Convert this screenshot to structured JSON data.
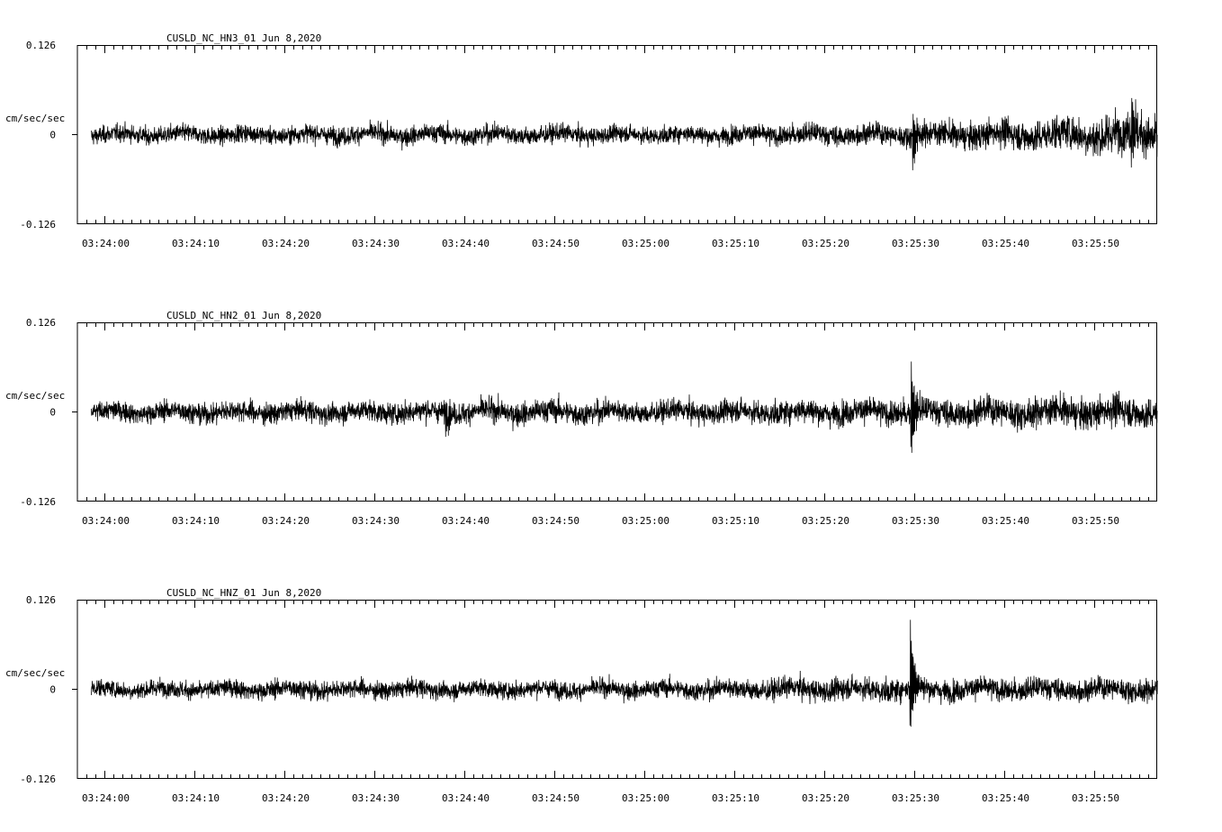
{
  "chart_data": [
    {
      "type": "line",
      "title": "CUSLD_NC_HN3_01  Jun 8,2020",
      "ylabel": "cm/sec/sec",
      "ylim": [
        -0.126,
        0.126
      ],
      "y_ticks": [
        "0.126",
        "0",
        "-0.126"
      ],
      "x_ticks": [
        "03:24:00",
        "03:24:10",
        "03:24:20",
        "03:24:30",
        "03:24:40",
        "03:24:50",
        "03:25:00",
        "03:25:10",
        "03:25:20",
        "03:25:30",
        "03:25:40",
        "03:25:50"
      ],
      "x_range_seconds": [
        -2.9,
        57.4
      ],
      "noise_envelope": [
        [
          -1.5,
          0.02
        ],
        [
          10,
          0.021
        ],
        [
          20,
          0.02
        ],
        [
          30,
          0.022
        ],
        [
          40,
          0.022
        ],
        [
          50,
          0.021
        ],
        [
          60,
          0.019
        ],
        [
          70,
          0.021
        ],
        [
          80,
          0.024
        ],
        [
          89,
          0.024
        ],
        [
          90,
          0.028
        ],
        [
          100,
          0.033
        ],
        [
          105,
          0.038
        ],
        [
          110,
          0.045
        ],
        [
          114,
          0.048
        ]
      ],
      "events": [
        {
          "x": 89.8,
          "max": 0.04,
          "min": -0.05
        },
        {
          "x": 114.1,
          "max": 0.06,
          "min": -0.03
        }
      ],
      "series": [
        {
          "values": []
        }
      ]
    },
    {
      "type": "line",
      "title": "CUSLD_NC_HN2_01  Jun 8,2020",
      "ylabel": "cm/sec/sec",
      "ylim": [
        -0.126,
        0.126
      ],
      "y_ticks": [
        "0.126",
        "0",
        "-0.126"
      ],
      "x_ticks": [
        "03:24:00",
        "03:24:10",
        "03:24:20",
        "03:24:30",
        "03:24:40",
        "03:24:50",
        "03:25:00",
        "03:25:10",
        "03:25:20",
        "03:25:30",
        "03:25:40",
        "03:25:50"
      ],
      "x_range_seconds": [
        -2.9,
        57.4
      ],
      "noise_envelope": [
        [
          -1.5,
          0.022
        ],
        [
          15,
          0.025
        ],
        [
          20,
          0.024
        ],
        [
          30,
          0.024
        ],
        [
          40,
          0.026
        ],
        [
          50,
          0.028
        ],
        [
          60,
          0.024
        ],
        [
          70,
          0.026
        ],
        [
          80,
          0.028
        ],
        [
          89,
          0.03
        ],
        [
          95,
          0.032
        ],
        [
          105,
          0.034
        ],
        [
          114,
          0.036
        ]
      ],
      "events": [
        {
          "x": 89.6,
          "max": 0.083,
          "min": -0.065
        },
        {
          "x": 37.9,
          "max": 0.02,
          "min": -0.03
        }
      ],
      "series": [
        {
          "values": []
        }
      ]
    },
    {
      "type": "line",
      "title": "CUSLD_NC_HNZ_01  Jun 8,2020",
      "ylabel": "cm/sec/sec",
      "ylim": [
        -0.126,
        0.126
      ],
      "y_ticks": [
        "0.126",
        "0",
        "-0.126"
      ],
      "x_ticks": [
        "03:24:00",
        "03:24:10",
        "03:24:20",
        "03:24:30",
        "03:24:40",
        "03:24:50",
        "03:25:00",
        "03:25:10",
        "03:25:20",
        "03:25:30",
        "03:25:40",
        "03:25:50"
      ],
      "x_range_seconds": [
        -2.9,
        57.4
      ],
      "noise_envelope": [
        [
          -1.5,
          0.02
        ],
        [
          10,
          0.02
        ],
        [
          20,
          0.022
        ],
        [
          30,
          0.021
        ],
        [
          40,
          0.02
        ],
        [
          50,
          0.02
        ],
        [
          60,
          0.021
        ],
        [
          70,
          0.023
        ],
        [
          80,
          0.026
        ],
        [
          89,
          0.027
        ],
        [
          95,
          0.025
        ],
        [
          105,
          0.026
        ],
        [
          114,
          0.025
        ]
      ],
      "events": [
        {
          "x": 89.5,
          "max": 0.11,
          "min": -0.065
        }
      ],
      "series": [
        {
          "values": []
        }
      ]
    }
  ]
}
